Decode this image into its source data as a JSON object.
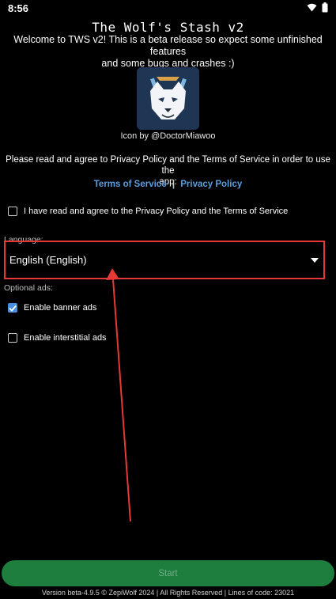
{
  "status": {
    "time": "8:56"
  },
  "app": {
    "title": "The Wolf's Stash v2",
    "welcome_line1": "Welcome to TWS v2! This is a beta release so expect some unfinished features",
    "welcome_line2": "and some bugs and crashes :)",
    "icon_credit": "Icon by @DoctorMiawoo"
  },
  "agreement": {
    "note_line1": "Please read and agree to Privacy Policy and the Terms of Service in order to use the",
    "note_line2": "app:",
    "terms_link": "Terms of Service",
    "separator": "|",
    "privacy_link": "Privacy Policy",
    "checkbox_label": "I have read and agree to the Privacy Policy and the Terms of Service",
    "checked": false
  },
  "language": {
    "label": "Language:",
    "selected": "English (English)"
  },
  "ads": {
    "label": "Optional ads:",
    "banner_label": "Enable banner ads",
    "banner_checked": true,
    "interstitial_label": "Enable interstitial ads",
    "interstitial_checked": false
  },
  "footer": {
    "start_label": "Start",
    "version_text": "Version beta-4.9.5 © ZepiWolf 2024 | All Rights Reserved | Lines of code: 23021"
  },
  "colors": {
    "accent_link": "#5b9ee0",
    "checkbox_checked": "#4a8de0",
    "start_button": "#1e7e3e",
    "annotation": "#e53935"
  },
  "icons": {
    "wifi": "wifi-icon",
    "battery": "battery-icon",
    "caret": "dropdown-caret-icon",
    "check": "checkmark-icon"
  }
}
